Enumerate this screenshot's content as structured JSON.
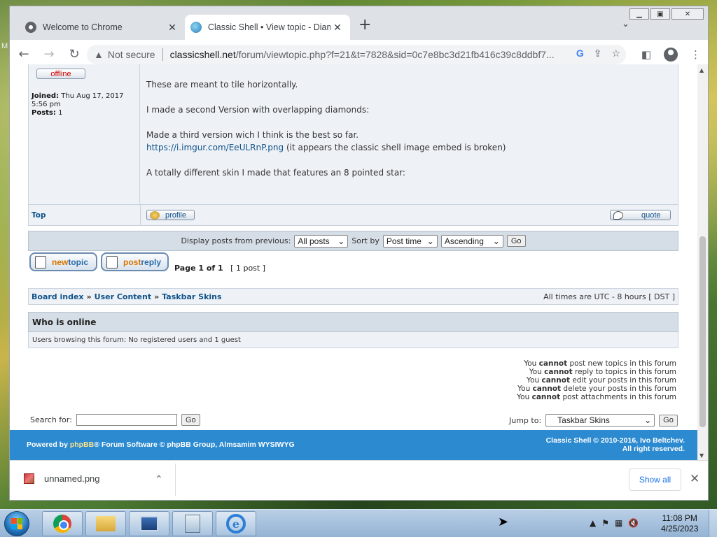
{
  "desktop": {
    "edge_text": "M"
  },
  "browser": {
    "tabs": [
      {
        "title": "Welcome to Chrome"
      },
      {
        "title": "Classic Shell • View topic - Diamc"
      }
    ],
    "omnibox": {
      "security": "Not secure",
      "domain": "classicshell.net",
      "path": "/forum/viewtopic.php?f=21&t=7828&sid=0c7e8bc3d21fb416c39c8ddbf7..."
    }
  },
  "post": {
    "status_badge": "offline",
    "joined_label": "Joined:",
    "joined_value": "Thu Aug 17, 2017 5:56 pm",
    "posts_label": "Posts:",
    "posts_value": "1",
    "para1": "These are meant to tile horizontally.",
    "para2": "I made a second Version with overlapping diamonds:",
    "para3": "Made a third version wich I think is the best so far.",
    "link": "https://i.imgur.com/EeULRnP.png",
    "link_suffix": " (it appears the classic shell image embed is broken)",
    "para4": "A totally different skin I made that features an 8 pointed star:",
    "top_link": "Top",
    "profile_label": "profile",
    "quote_label": "quote"
  },
  "display_bar": {
    "display_label": "Display posts from previous:",
    "display_value": "All posts",
    "sort_label": "Sort by",
    "sort_value": "Post time",
    "order_value": "Ascending",
    "go_label": "Go"
  },
  "actions": {
    "newtopic_a": "new",
    "newtopic_b": "topic",
    "postreply_a": "post",
    "postreply_b": "reply",
    "page_text": "Page 1 of 1",
    "post_count": "[ 1 post ]"
  },
  "breadcrumb": {
    "items": [
      "Board index",
      "User Content",
      "Taskbar Skins"
    ],
    "separator": "»",
    "timezone": "All times are UTC - 8 hours [ DST ]"
  },
  "who_is_online": {
    "heading": "Who is online",
    "text": "Users browsing this forum: No registered users and 1 guest"
  },
  "permissions": [
    {
      "pre": "You",
      "strong": "cannot",
      "post": "post new topics in this forum"
    },
    {
      "pre": "You",
      "strong": "cannot",
      "post": "reply to topics in this forum"
    },
    {
      "pre": "You",
      "strong": "cannot",
      "post": "edit your posts in this forum"
    },
    {
      "pre": "You",
      "strong": "cannot",
      "post": "delete your posts in this forum"
    },
    {
      "pre": "You",
      "strong": "cannot",
      "post": "post attachments in this forum"
    }
  ],
  "search": {
    "label": "Search for:",
    "go_label": "Go"
  },
  "jump": {
    "label": "Jump to:",
    "value": "Taskbar Skins",
    "go_label": "Go"
  },
  "footer": {
    "powered_prefix": "Powered by ",
    "phpbb": "phpBB",
    "powered_suffix": "® Forum Software © phpBB Group, Almsamim WYSIWYG",
    "copyright_line1": "Classic Shell © 2010-2016, Ivo Beltchev.",
    "copyright_line2": "All right reserved."
  },
  "downloads": {
    "file_name": "unnamed.png",
    "show_all": "Show all"
  },
  "taskbar": {
    "time": "11:08 PM",
    "date": "4/25/2023"
  }
}
